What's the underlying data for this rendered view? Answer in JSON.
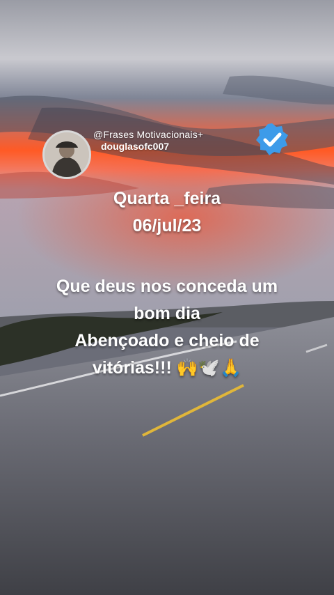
{
  "post": {
    "handle": "@Frases Motivacionais+",
    "username": "douglasofc007",
    "day": "Quarta _feira",
    "date": "06/jul/23",
    "message_lines": [
      "Que deus nos conceda um",
      "bom dia",
      "Abençoado e cheio de",
      "vitórias!!! 🙌🕊️🙏"
    ]
  },
  "icons": {
    "verified": "verified-badge-icon",
    "avatar": "profile-avatar"
  },
  "colors": {
    "verified_blue": "#3d9be9",
    "text": "#ffffff",
    "sunset_orange": "#ff6a2a"
  }
}
